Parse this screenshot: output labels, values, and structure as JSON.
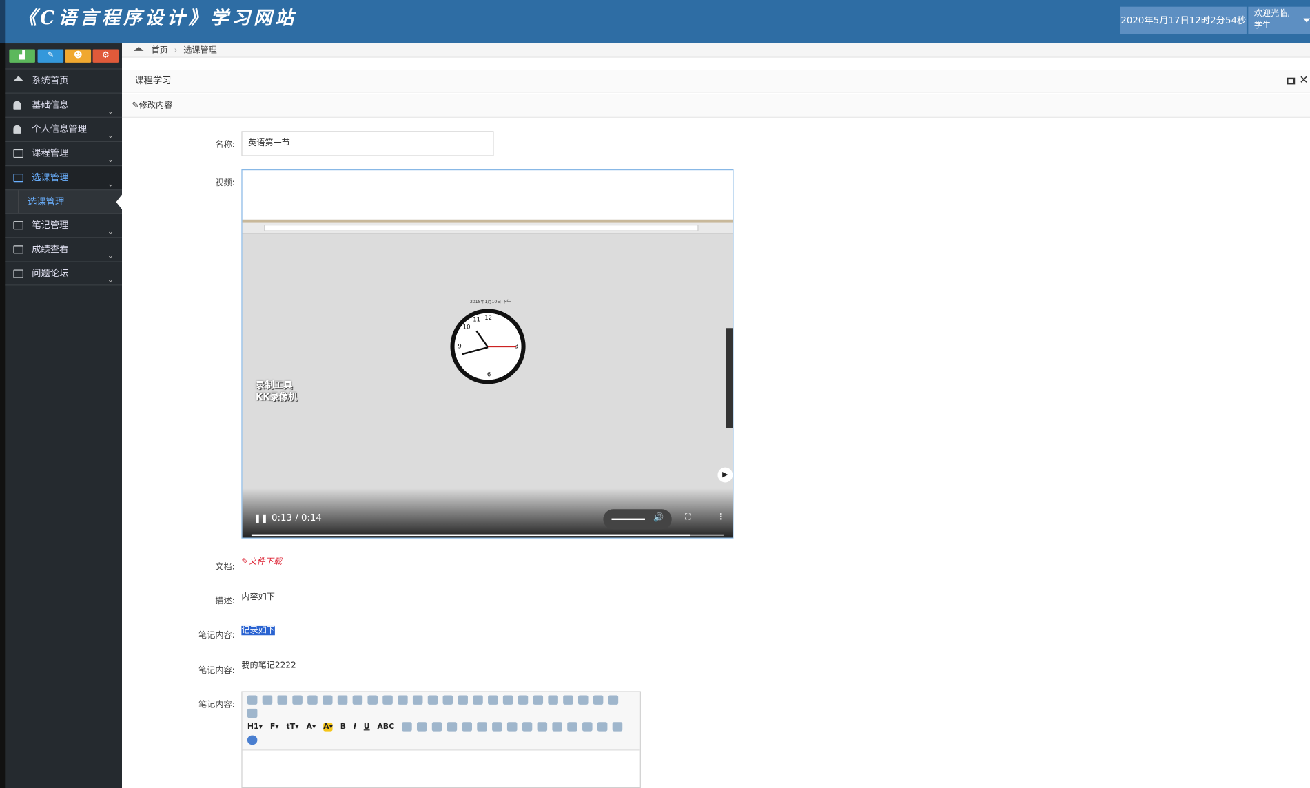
{
  "header": {
    "title": "《C语言程序设计》学习网站",
    "datetime": "2020年5月17日12时2分54秒",
    "welcome": "欢迎光临,",
    "role": "学生"
  },
  "sidebar": {
    "shortcuts": [
      {
        "icon": "signal-icon",
        "color": "#5cb85c"
      },
      {
        "icon": "pencil-icon",
        "color": "#3498db"
      },
      {
        "icon": "users-icon",
        "color": "#f0a830"
      },
      {
        "icon": "cogs-icon",
        "color": "#e05a3a"
      }
    ],
    "items": [
      {
        "label": "系统首页"
      },
      {
        "label": "基础信息"
      },
      {
        "label": "个人信息管理"
      },
      {
        "label": "课程管理"
      },
      {
        "label": "选课管理"
      },
      {
        "label": "选课管理"
      },
      {
        "label": "笔记管理"
      },
      {
        "label": "成绩查看"
      },
      {
        "label": "问题论坛"
      }
    ]
  },
  "breadcrumb": {
    "home": "首页",
    "current": "选课管理"
  },
  "page_title": "课程学习",
  "section_header": "修改内容",
  "form": {
    "name_label": "名称:",
    "name_value": "英语第一节",
    "video_label": "视频:",
    "video": {
      "time": "0:13 / 0:14",
      "progress": 0.93,
      "volume": 0.6,
      "clock_caption": "2018年1月10日 下午",
      "watermark_line1": "录制工具",
      "watermark_line2": "KK录像机"
    },
    "doc_label": "文档:",
    "doc_link": "文件下载",
    "desc_label": "描述:",
    "desc_value": "内容如下",
    "note_label1": "笔记内容:",
    "note_value1": "记录如下",
    "note_label2": "笔记内容:",
    "note_value2": "我的笔记2222",
    "note_label3": "笔记内容:"
  }
}
